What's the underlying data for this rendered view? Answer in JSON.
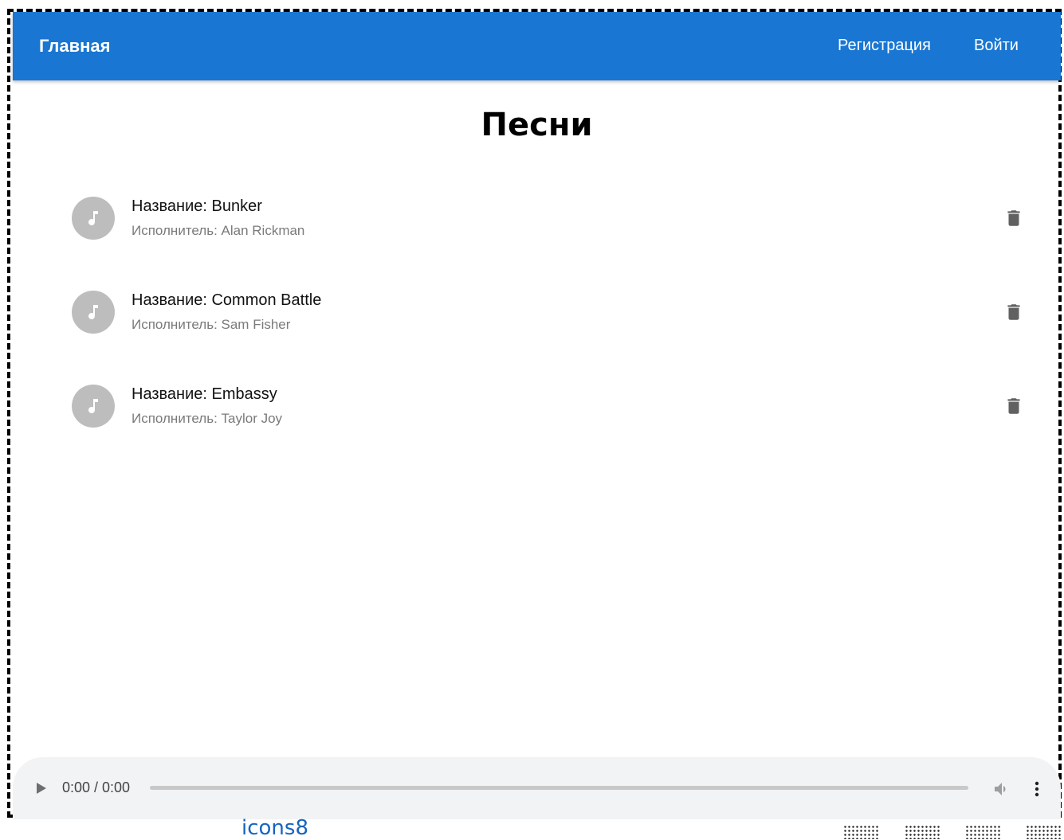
{
  "appbar": {
    "brand": "Главная",
    "register_label": "Регистрация",
    "login_label": "Войти",
    "color": "#1976d2"
  },
  "page": {
    "title": "Песни"
  },
  "songs": [
    {
      "title": "Название: Bunker",
      "artist": "Исполнитель: Alan Rickman"
    },
    {
      "title": "Название: Common Battle",
      "artist": "Исполнитель: Sam Fisher"
    },
    {
      "title": "Название: Embassy",
      "artist": "Исполнитель: Taylor Joy"
    }
  ],
  "player": {
    "time": "0:00 / 0:00"
  },
  "footer": {
    "credit": "icons8"
  },
  "icons": {
    "avatar": "music-note-icon",
    "delete": "trash-icon",
    "play": "play-icon",
    "volume": "volume-icon",
    "more": "more-vert-icon"
  }
}
